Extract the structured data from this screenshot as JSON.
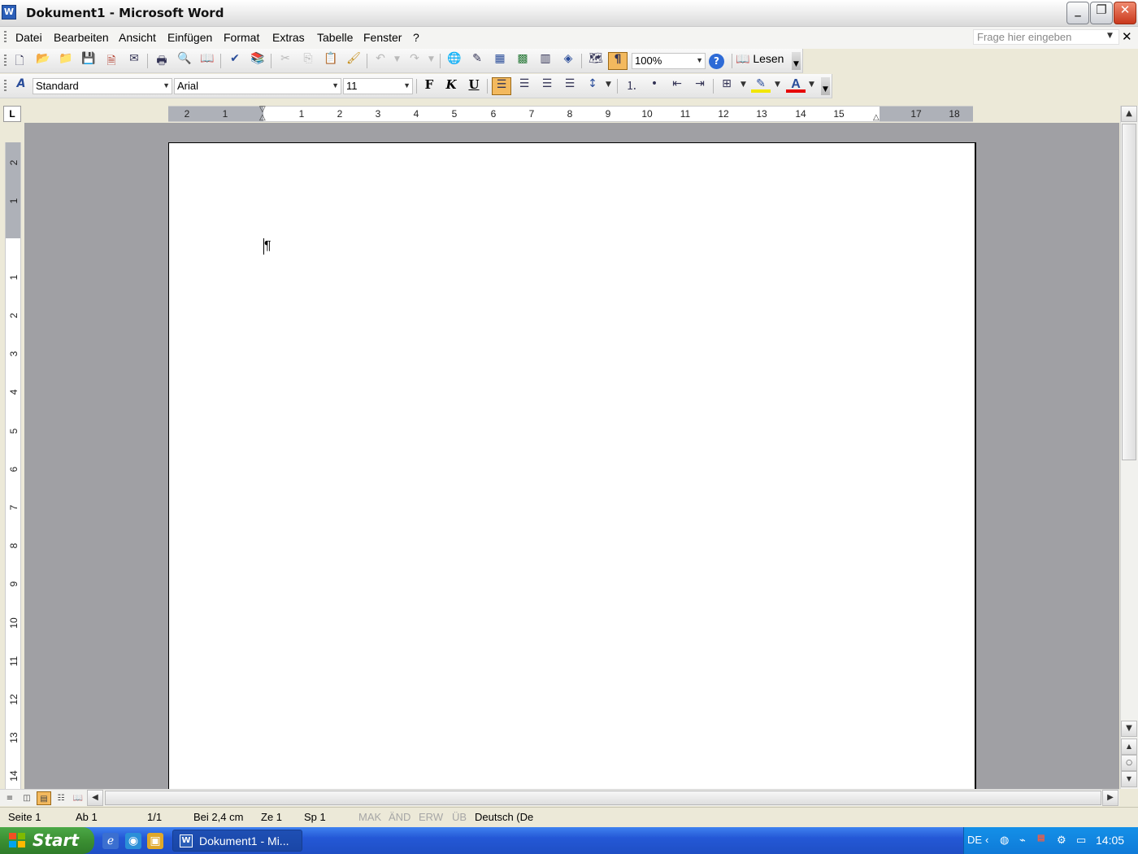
{
  "window": {
    "title": "Dokument1 - Microsoft Word",
    "app_icon": "W"
  },
  "menu": {
    "items": [
      "Datei",
      "Bearbeiten",
      "Ansicht",
      "Einfügen",
      "Format",
      "Extras",
      "Tabelle",
      "Fenster",
      "?"
    ],
    "ask_placeholder": "Frage hier eingeben"
  },
  "toolbar_standard": {
    "zoom": "100%",
    "read_label": "Lesen"
  },
  "toolbar_format": {
    "style": "Standard",
    "font": "Arial",
    "size": "11",
    "bold_label": "F",
    "italic_label": "K",
    "underline_label": "U",
    "font_color_label": "A"
  },
  "ruler": {
    "tab_label": "L",
    "horizontal_numbers": [
      "2",
      "1",
      "1",
      "2",
      "3",
      "4",
      "5",
      "6",
      "7",
      "8",
      "9",
      "10",
      "11",
      "12",
      "13",
      "14",
      "15",
      "17",
      "18"
    ],
    "vertical_numbers": [
      "2",
      "1",
      "1",
      "2",
      "3",
      "4",
      "5",
      "6",
      "7",
      "8",
      "9",
      "10",
      "11",
      "12",
      "13",
      "14"
    ]
  },
  "document": {
    "pilcrow": "¶"
  },
  "status": {
    "page": "Seite 1",
    "section": "Ab 1",
    "pages": "1/1",
    "position": "Bei 2,4 cm",
    "line": "Ze 1",
    "column": "Sp 1",
    "mak": "MAK",
    "aend": "ÄND",
    "erw": "ERW",
    "ueb": "ÜB",
    "language": "Deutsch (De"
  },
  "taskbar": {
    "start_label": "Start",
    "task_word": "Dokument1 - Mi...",
    "tray_lang": "DE",
    "clock": "14:05"
  }
}
